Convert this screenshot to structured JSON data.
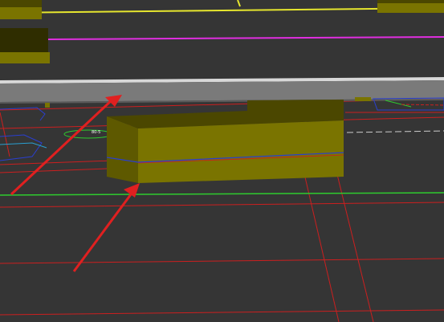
{
  "scene": {
    "colors": {
      "background": "#353535",
      "box_front": "#7a7400",
      "box_top": "#4b4700",
      "box_side": "#5e5900",
      "wall_top": "#8a8a8a",
      "wall_front": "#6f6f6f",
      "grid_line": "#cc1f1f",
      "lane_green": "#2ecc2e",
      "lane_yellow": "#e6e62e",
      "lane_magenta": "#e02ee0",
      "outline_blue": "#2a3fd0",
      "outline_cyan": "#2a9fd0",
      "arrow": "#e02020"
    },
    "labels": {
      "small_tag_1": "80-5",
      "small_tag_2": "▪"
    }
  }
}
